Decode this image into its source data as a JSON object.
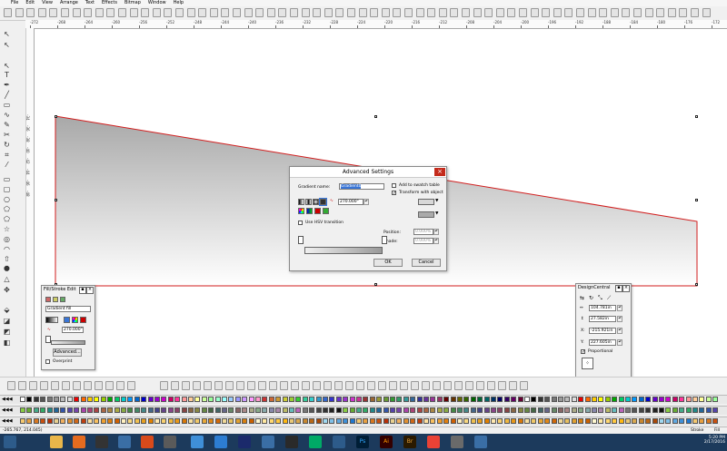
{
  "menu": [
    "File",
    "Edit",
    "View",
    "Arrange",
    "Text",
    "Effects",
    "Bitmap",
    "Window",
    "Help"
  ],
  "ruler": {
    "h_labels": [
      "-272",
      "-268",
      "-264",
      "-260",
      "-256",
      "-252",
      "-248",
      "-244",
      "-240",
      "-236",
      "-232",
      "-228",
      "-224",
      "-220",
      "-216",
      "-212",
      "-208",
      "-204",
      "-200",
      "-196",
      "-192",
      "-188",
      "-184",
      "-180",
      "-176",
      "-172"
    ],
    "v_labels": [
      "-34",
      "-36",
      "-38",
      "-40",
      "-42",
      "-44",
      "-46",
      "-48"
    ]
  },
  "dialog": {
    "title": "Advanced Settings",
    "gradient_name_label": "Gradient name:",
    "gradient_name_value": "Gradient0",
    "add_to_swatch_label": "Add to swatch table",
    "transform_label": "Transform with object",
    "transform_checked": "✓",
    "angle_value": "270.000°",
    "hsv_label": "Use HSV transition",
    "position_label": "Position:",
    "position_value": "0.000%",
    "shade_label": "Shade:",
    "shade_value": "0.000%",
    "ok": "OK",
    "cancel": "Cancel"
  },
  "fillstroke": {
    "title": "Fill/Stroke Edit",
    "fill_type": "Gradient fill",
    "angle_value": "270.000°",
    "advanced": "Advanced...",
    "overprint": "Overprint"
  },
  "designcentral": {
    "title": "DesignCentral",
    "w_value": "104.781in",
    "h_value": "27.582in",
    "x_value": "-215.921in",
    "y_value": "227.605in",
    "x_label": "X:",
    "y_label": "Y:",
    "proportional": "Proportional",
    "proportional_checked": "✓"
  },
  "status": {
    "coords": "-265.767,  214.045)",
    "mode": "Stroke",
    "fill": "Fill"
  },
  "clock": {
    "time": "5:20 PM",
    "date": "2/17/2016"
  },
  "colors": {
    "selection_outline": "#d11d1d",
    "gradient_top": "#a8a8a8",
    "gradient_bottom": "#ffffff",
    "taskbar": "#1c3a5c"
  }
}
